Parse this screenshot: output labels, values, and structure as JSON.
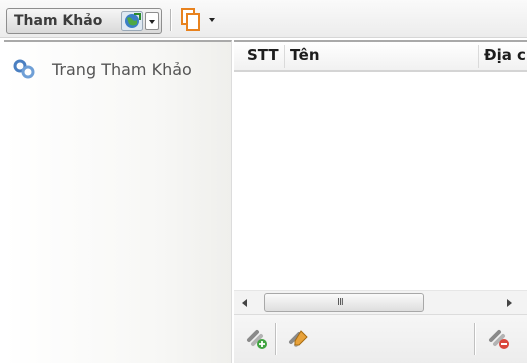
{
  "toolbar": {
    "reference_label": "Tham Khảo",
    "reference_icon": "globe-refresh-icon",
    "copy_icon": "copy-pages-icon"
  },
  "left_panel": {
    "items": [
      {
        "label": "Trang Tham Khảo",
        "icon": "link-chain-icon"
      }
    ]
  },
  "grid": {
    "columns": [
      "STT",
      "Tên",
      "Địa chỉ"
    ],
    "rows": []
  },
  "scrollbar": {
    "grip": "III"
  },
  "actions": {
    "add_icon": "add-link-icon",
    "edit_icon": "edit-link-icon",
    "delete_icon": "delete-link-icon"
  },
  "colors": {
    "icon_orange": "#e8821e",
    "icon_green": "#3fa33f",
    "icon_red": "#d9463b",
    "link_blue": "#4a7fc1"
  }
}
